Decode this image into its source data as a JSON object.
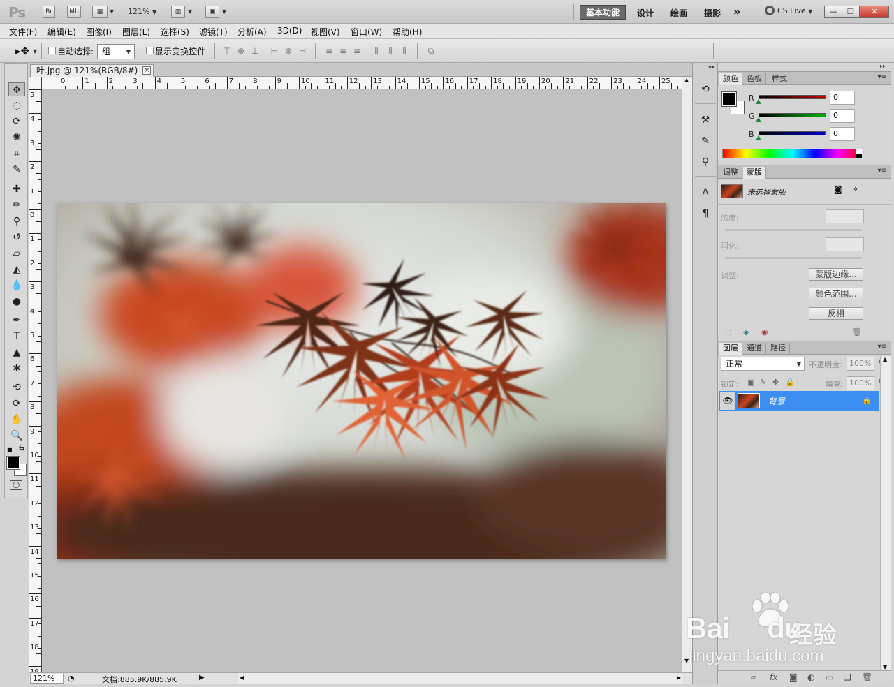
{
  "app": {
    "logo": "Ps",
    "bridge_button": "Br",
    "minibridge_button": "Mb",
    "zoom": "121%",
    "workspaces": [
      "基本功能",
      "设计",
      "绘画",
      "摄影"
    ],
    "more_workspaces": "»",
    "cs_live": "CS Live",
    "win_minimize": "—",
    "win_restore": "❐",
    "win_close": "✕"
  },
  "menubar": {
    "items": [
      "文件(F)",
      "编辑(E)",
      "图像(I)",
      "图层(L)",
      "选择(S)",
      "滤镜(T)",
      "分析(A)",
      "3D(D)",
      "视图(V)",
      "窗口(W)",
      "帮助(H)"
    ]
  },
  "options": {
    "auto_select_label": "自动选择:",
    "auto_select_value": "组",
    "show_transform_label": "显示变换控件"
  },
  "document": {
    "tab_title": "叶.jpg @ 121%(RGB/8#)",
    "close_symbol": "×",
    "ruler_h": [
      "0",
      "1",
      "2",
      "3",
      "4",
      "5",
      "6",
      "7",
      "8",
      "9",
      "10",
      "11",
      "12",
      "13",
      "14",
      "15",
      "16",
      "17",
      "18",
      "19",
      "20",
      "21",
      "22",
      "23",
      "24",
      "25"
    ],
    "ruler_v": [
      "5",
      "4",
      "3",
      "2",
      "1",
      "0",
      "1",
      "2",
      "3",
      "4",
      "5",
      "6",
      "7",
      "8",
      "9",
      "10",
      "11",
      "12",
      "13",
      "14",
      "15",
      "16",
      "17",
      "18",
      "19"
    ],
    "status_zoom": "121%",
    "status_doc": "文档:885.9K/885.9K",
    "status_arrow": "▶"
  },
  "color_panel": {
    "tabs": [
      "颜色",
      "色板",
      "样式"
    ],
    "r_label": "R",
    "g_label": "G",
    "b_label": "B",
    "r_value": "0",
    "g_value": "0",
    "b_value": "0",
    "r_color": "#cc0000",
    "g_color": "#00b300",
    "b_color": "#0000cc"
  },
  "mask_panel": {
    "tabs": [
      "调整",
      "蒙版"
    ],
    "no_mask_text": "未选择蒙版",
    "density_label": "浓度:",
    "feather_label": "羽化:",
    "refine_label": "调整:",
    "btn_mask_edge": "蒙版边缘...",
    "btn_color_range": "颜色范围...",
    "btn_invert": "反相"
  },
  "layers_panel": {
    "tabs": [
      "图层",
      "通道",
      "路径"
    ],
    "blend_mode": "正常",
    "opacity_label": "不透明度:",
    "opacity_value": "100%",
    "lock_label": "锁定:",
    "fill_label": "填充:",
    "fill_value": "100%",
    "layer_name": "背景",
    "selected_color": "#3d8ef2"
  },
  "watermark": {
    "brand": "Bai",
    "brand2": "du",
    "cn": "经验",
    "url": "jingyan.baidu.com"
  }
}
